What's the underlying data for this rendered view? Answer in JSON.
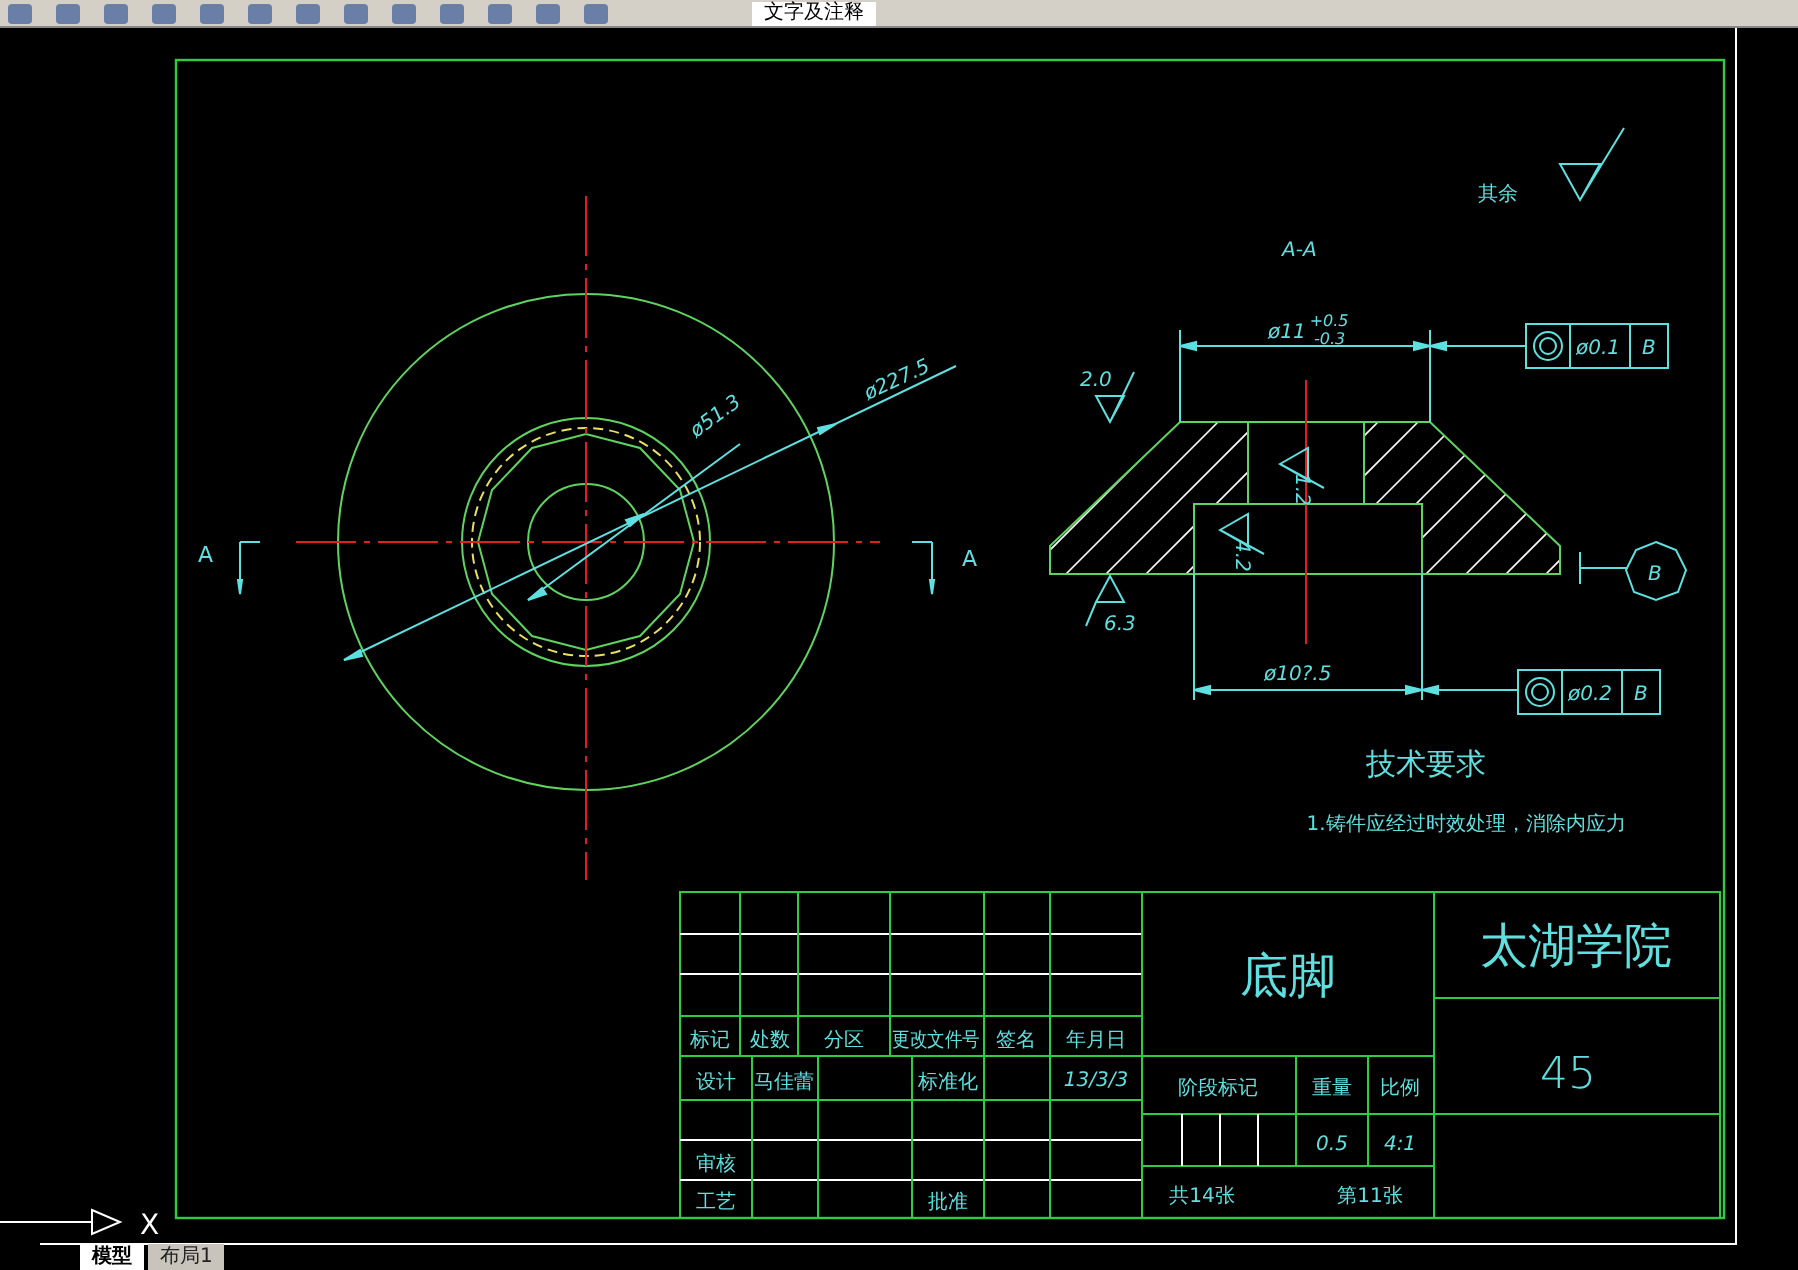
{
  "toolbar": {
    "layer_name": "文字及注释"
  },
  "drawing": {
    "front_view": {
      "section_marks": [
        "A",
        "A"
      ],
      "diameters": [
        "ø227.5",
        "ø51.3"
      ]
    },
    "section_view": {
      "label": "A-A",
      "general_roughness": "其余",
      "top_diameter": {
        "value": "ø11",
        "upper_tolerance": "+0.5",
        "lower_tolerance": "-0.3"
      },
      "bottom_diameter": {
        "value": "ø10?.5"
      },
      "roughness": [
        "2.0",
        "1.2",
        "4.2",
        "6.3"
      ],
      "tolerance_frames": [
        {
          "kind": "concentricity",
          "tolerance": "ø0.1",
          "datum": "B"
        },
        {
          "kind": "concentricity",
          "tolerance": "ø0.2",
          "datum": "B"
        }
      ],
      "datum": "B"
    },
    "technical_requirements": {
      "heading": "技术要求",
      "items": [
        "1.铸件应经过时效处理，消除内应力"
      ]
    },
    "title_block": {
      "revision_headers": [
        "标记",
        "处数",
        "分区",
        "更改文件号",
        "签名",
        "年月日"
      ],
      "design_label": "设计",
      "designer": "马佳蕾",
      "standardization_label": "标准化",
      "date": "13/3/3",
      "review_label": "审核",
      "process_label": "工艺",
      "approval_label": "批准",
      "part_name": "底脚",
      "stage_label": "阶段标记",
      "weight_label": "重量",
      "scale_label": "比例",
      "weight": "0.5",
      "scale": "4:1",
      "sheet_total": "共14张",
      "sheet_number": "第11张",
      "school": "太湖学院",
      "material": "45"
    },
    "ucs": {
      "axis": "X"
    }
  },
  "layout_tabs": [
    {
      "label": "模型",
      "selected": true
    },
    {
      "label": "布局1",
      "selected": false
    }
  ]
}
